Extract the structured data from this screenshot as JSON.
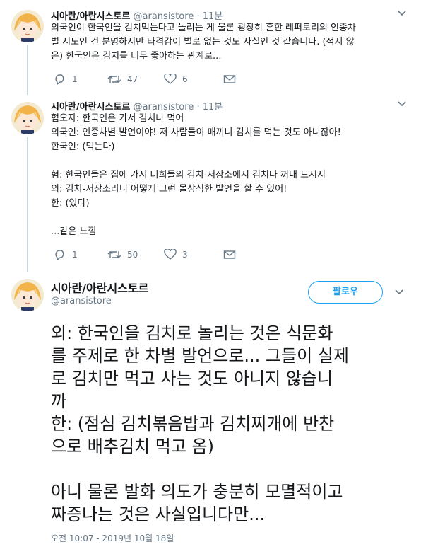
{
  "tweets": [
    {
      "name": "시아란/아란시스토르",
      "handle": "@aransistore",
      "dot": "·",
      "time": "11분",
      "text": "외국인이 한국인을 김치먹는다고 놀리는 게 물론 굉장히 흔한 레퍼토리의 인종차\n별 시도인 건 분명하지만 타격감이 별로 없는 것도 사실인 것 같습니다. (적지 않\n은) 한국인은 김치를 너무 좋아하는 관계로...",
      "replies": "1",
      "retweets": "47",
      "likes": "6"
    },
    {
      "name": "시아란/아란시스토르",
      "handle": "@aransistore",
      "dot": "·",
      "time": "11분",
      "text": "혐오자: 한국인은 가서 김치나 먹어\n외국인: 인종차별 발언이야! 저 사람들이 매끼니 김치를 먹는 것도 아니잖아!\n한국인: (먹는다)\n\n혐: 한국인들은 집에 가서 너희들의 김치-저장소에서 김치나 꺼내 드시지\n외: 김치-저장소라니 어떻게 그런 몰상식한 발언을 할 수 있어!\n한: (있다)\n\n...같은 느낌",
      "replies": "1",
      "retweets": "50",
      "likes": "3"
    }
  ],
  "main": {
    "name": "시아란/아란시스토르",
    "handle": "@aransistore",
    "follow_label": "팔로우",
    "text": "외: 한국인을 김치로 놀리는 것은 식문화\n를 주제로 한 차별 발언으로... 그들이 실제\n로 김치만 먹고 사는 것도 아니지 않습니\n까\n한: (점심 김치볶음밥과 김치찌개에 반찬\n으로 배추김치 먹고 옴)\n\n아니 물론 발화 의도가 충분히 모멸적이고\n짜증나는 것은 사실입니다만...",
    "timestamp": "오전 10:07 - 2019년 10월 18일"
  }
}
